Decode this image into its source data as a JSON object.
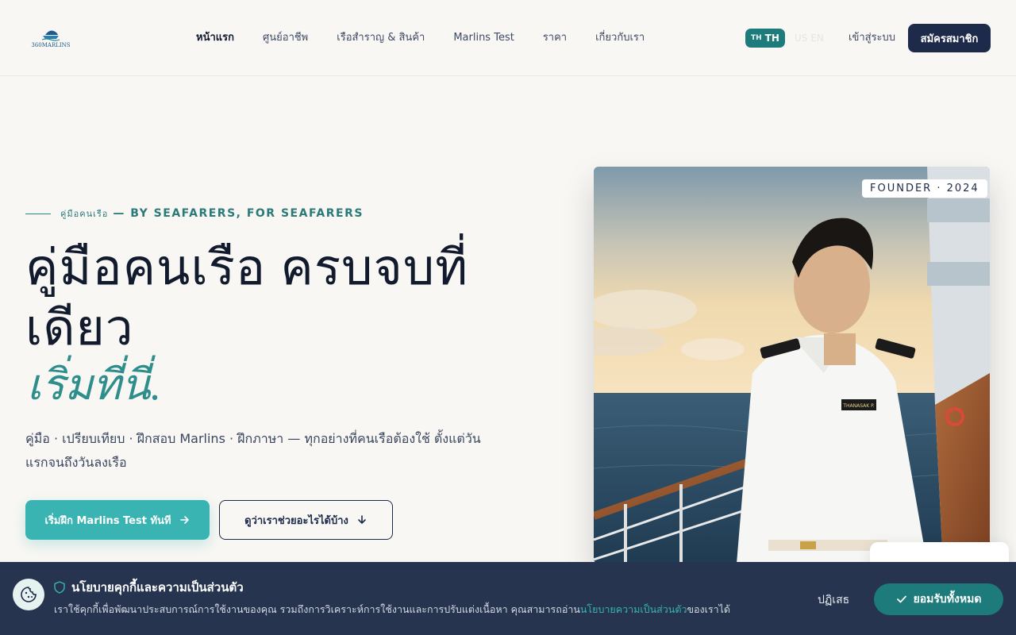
{
  "brand": {
    "logo_text": "360MARLINS"
  },
  "nav": {
    "items": [
      {
        "label": "หน้าแรก",
        "active": true
      },
      {
        "label": "ศูนย์อาชีพ"
      },
      {
        "label": "เรือสำราญ & สินค้า"
      },
      {
        "label": "Marlins Test"
      },
      {
        "label": "ราคา"
      },
      {
        "label": "เกี่ยวกับเรา"
      }
    ]
  },
  "lang": {
    "th_flag": "TH",
    "th_label": "TH",
    "en_flag": "US",
    "en_label": "EN"
  },
  "auth": {
    "login": "เข้าสู่ระบบ",
    "signup": "สมัครสมาชิก"
  },
  "hero": {
    "eyebrow_small": "คู่มือคนเรือ",
    "eyebrow_big": "— BY SEAFARERS, FOR SEAFARERS",
    "title": "คู่มือคนเรือ ครบจบที่เดียว",
    "accent": "เริ่มที่นี่.",
    "description": "คู่มือ · เปรียบเทียบ · ฝึกสอบ Marlins · ฝึกภาษา — ทุกอย่างที่คนเรือต้องใช้ ตั้งแต่วันแรกจนถึงวันลงเรือ",
    "cta_primary": "เริ่มฝึก Marlins Test ทันที",
    "cta_secondary": "ดูว่าเราช่วยอะไรได้บ้าง",
    "badge": "FOUNDER · 2024",
    "nameplate": "THANASAK P."
  },
  "cookie": {
    "title": "นโยบายคุกกี้และความเป็นส่วนตัว",
    "text_before": "เราใช้คุกกี้เพื่อพัฒนาประสบการณ์การใช้งานของคุณ รวมถึงการวิเคราะห์การใช้งานและการปรับแต่งเนื้อหา คุณสามารถอ่าน",
    "link": "นโยบายความเป็นส่วนตัว",
    "text_after": "ของเราได้",
    "decline": "ปฏิเสธ",
    "accept": "ยอมรับทั้งหมด"
  },
  "colors": {
    "navy": "#1d2a4a",
    "teal": "#1e7b7b",
    "teal_light": "#3ab3b3",
    "background": "#f8f7f3",
    "cookie_bg": "#26344f"
  },
  "icons": [
    "ship-logo-icon",
    "arrow-right-icon",
    "arrow-down-icon",
    "cookie-icon",
    "shield-icon",
    "check-icon"
  ]
}
